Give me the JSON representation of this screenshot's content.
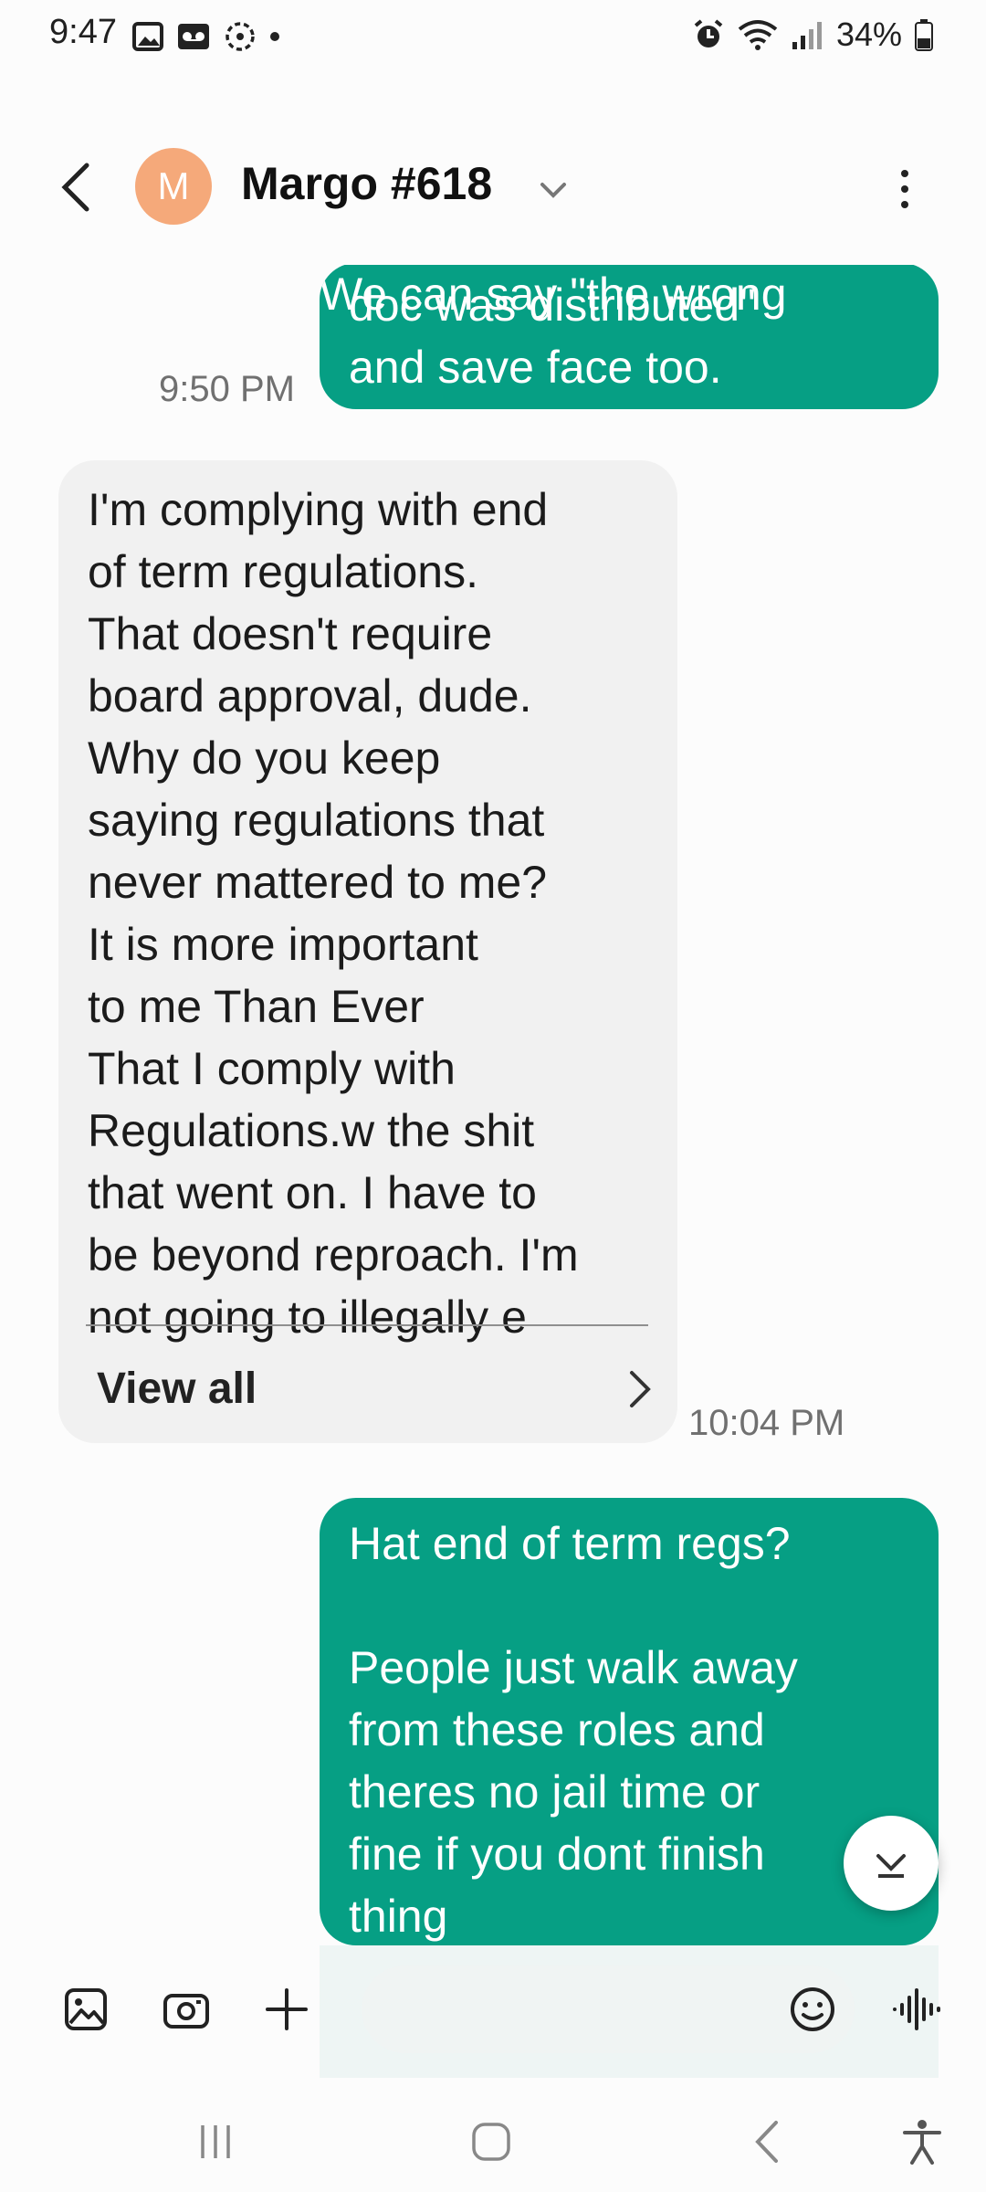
{
  "status_bar": {
    "time": "9:47",
    "battery": "34%"
  },
  "header": {
    "avatar_letter": "M",
    "contact_name": "Margo #618"
  },
  "messages": [
    {
      "direction": "outgoing",
      "partial_top_line": "We can say \"the wrong",
      "text": "doc was distributed\"\nand save face too.",
      "time": "9:50 PM"
    },
    {
      "direction": "incoming",
      "text": "I'm complying with end\nof term regulations.\nThat doesn't require\nboard approval, dude.\nWhy do you keep\nsaying regulations that\nnever mattered to me?\nIt is more important\nto me Than Ever\nThat I comply with\nRegulations.w the shit\nthat went on. I have to\nbe beyond reproach. I'm\nnot going to illegally e",
      "view_all_label": "View all",
      "time": "10:04 PM"
    },
    {
      "direction": "outgoing",
      "text": "Hat end of term regs?\n\nPeople just walk away\nfrom these roles and\ntheres no jail time or\nfine if you dont finish\nthing"
    }
  ],
  "composer": {
    "placeholder": "",
    "value": ""
  },
  "colors": {
    "outgoing_bubble": "#069f84",
    "incoming_bubble": "#f1f1f1",
    "avatar": "#f5a97a"
  }
}
